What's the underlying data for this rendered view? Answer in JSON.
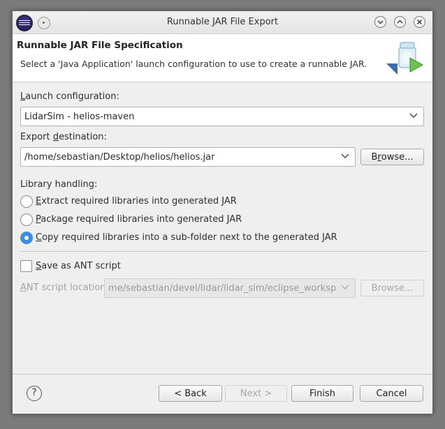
{
  "window": {
    "title": "Runnable JAR File Export",
    "controls": [
      "minimize",
      "maximize",
      "close"
    ]
  },
  "header": {
    "title": "Runnable JAR File Specification",
    "description": "Select a 'Java Application' launch configuration to use to create a runnable JAR."
  },
  "launch": {
    "label_underlined": "L",
    "label_rest": "aunch configuration:",
    "value": "LidarSim - helios-maven"
  },
  "export": {
    "label_before": "Export ",
    "label_underlined": "d",
    "label_after": "estination:",
    "value": "/home/sebastian/Desktop/helios/helios.jar",
    "browse_before": "B",
    "browse_underlined": "r",
    "browse_after": "owse..."
  },
  "library": {
    "label": "Library handling:",
    "options": [
      {
        "underlined": "E",
        "rest": "xtract required libraries into generated JAR",
        "checked": false
      },
      {
        "underlined": "P",
        "rest": "ackage required libraries into generated JAR",
        "checked": false
      },
      {
        "underlined": "C",
        "rest": "opy required libraries into a sub-folder next to the generated JAR",
        "checked": true
      }
    ]
  },
  "ant": {
    "checkbox_underlined": "S",
    "checkbox_rest": "ave as ANT script",
    "checked": false,
    "location_underlined": "A",
    "location_rest": "NT script location:",
    "location_value": "me/sebastian/devel/lidar/lidar_sim/eclipse_workspace",
    "browse_label": "Browse..."
  },
  "footer": {
    "help_symbol": "?",
    "back": "< Back",
    "next": "Next >",
    "finish": "Finish",
    "cancel": "Cancel"
  },
  "colors": {
    "accent": "#3d8ee0",
    "window_bg": "#efefef",
    "desktop_bg": "#7b7b7b"
  }
}
